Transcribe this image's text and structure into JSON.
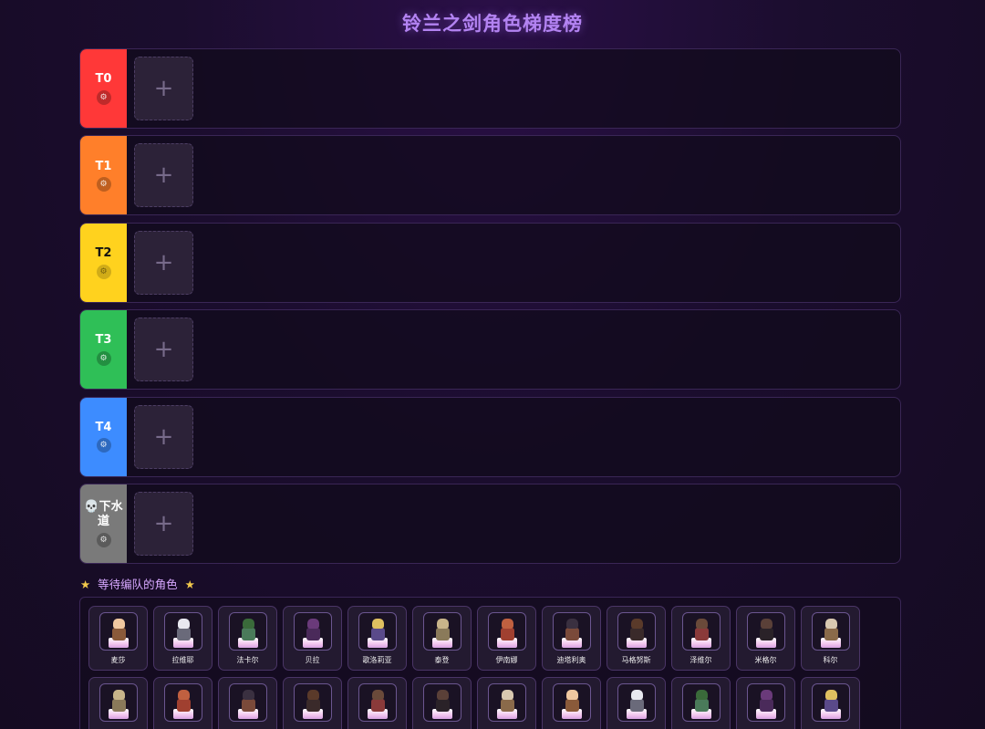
{
  "title": "铃兰之剑角色梯度榜",
  "tiers": [
    {
      "label": "T0",
      "color": "#ff3838",
      "add": "+"
    },
    {
      "label": "T1",
      "color": "#ff7f2a",
      "add": "+"
    },
    {
      "label": "T2",
      "color": "#ffd21e",
      "add": "+"
    },
    {
      "label": "T3",
      "color": "#2fbf57",
      "add": "+"
    },
    {
      "label": "T4",
      "color": "#3d8cff",
      "add": "+"
    },
    {
      "label": "💀下水道",
      "color": "#7a7a7a",
      "add": "+"
    }
  ],
  "pool": {
    "title": "等待编队的角色",
    "star": "★",
    "row1": [
      "麦莎",
      "拉维耶",
      "法卡尔",
      "贝拉",
      "歌洛莉亚",
      "泰登",
      "伊南娜",
      "迪塔利奥",
      "马格努斯",
      "泽维尔",
      "米格尔",
      "科尔"
    ],
    "row2": [
      "",
      "",
      "",
      "",
      "",
      "",
      "",
      "",
      "",
      "",
      "",
      ""
    ]
  },
  "settings_icon": "gear-icon"
}
